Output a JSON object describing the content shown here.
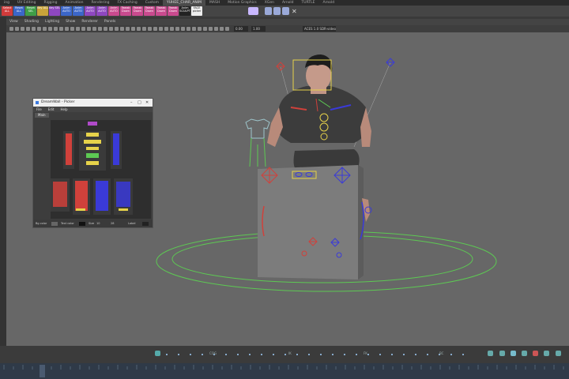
{
  "shelf_tabs": [
    "ing",
    "UV Editing",
    "Rigging",
    "Animation",
    "Rendering",
    "FX Caching",
    "Custom",
    "YUHEE_CHAR_ANIM",
    "MASH",
    "Motion Graphics",
    "XGen",
    "Arnold",
    "TURTLE",
    "Arnold"
  ],
  "active_shelf_tab_index": 7,
  "shelf_buttons": [
    {
      "label": "Select ALL",
      "color": "#d23b3b"
    },
    {
      "label": "Reset ALL",
      "color": "#3b66c9"
    },
    {
      "label": "Reset SEL",
      "color": "#3f9e47"
    },
    {
      "label": "Key ALL",
      "color": "#c9a33a"
    },
    {
      "label": "Key SEL",
      "color": "#8e47c0"
    },
    {
      "label": "Anim AUTO",
      "color": "#3b66c9"
    },
    {
      "label": "Anim AUTO",
      "color": "#3b66c9"
    },
    {
      "label": "Anim AUTO",
      "color": "#8e47c0"
    },
    {
      "label": "Anim AUTO",
      "color": "#8e47c0"
    },
    {
      "label": "Anim AUTO",
      "color": "#c94a8e"
    },
    {
      "label": "Tweak Down",
      "color": "#c94a8e"
    },
    {
      "label": "Tweak Down",
      "color": "#c94a8e"
    },
    {
      "label": "Tweak Down",
      "color": "#c94a8e"
    },
    {
      "label": "Tweak Down",
      "color": "#c94a8e"
    },
    {
      "label": "Tweak Down",
      "color": "#c94a8e"
    },
    {
      "label": "Anim SCULPT",
      "color": "#222"
    },
    {
      "label": "FACE picker",
      "color": "#eee"
    }
  ],
  "viewport_menu": [
    "View",
    "Shading",
    "Lighting",
    "Show",
    "Renderer",
    "Panels"
  ],
  "viewport_fields": {
    "exposure": "0.00",
    "gamma": "1.00",
    "color_space": "ACES 1.0 SDR-video (sRGB)"
  },
  "picker": {
    "title": "DreamWall - Picker",
    "menu": [
      "File",
      "Edit",
      "Help"
    ],
    "tab": "Main",
    "footer": {
      "bg_color_label": "Bg color",
      "text_color_label": "Text color",
      "size_label": "Size",
      "size_value": "10",
      "width_value": "28",
      "label_label": "Label"
    }
  },
  "timeline": {
    "markers": [
      "COG",
      "IK",
      "FK",
      "BC"
    ]
  },
  "colors": {
    "viewport": "#676767",
    "control_red": "#d0413b",
    "control_blue": "#3a3ad8",
    "ground_circle": "#5dc953",
    "ik_yellow": "#e6d24a",
    "picker_bg": "#2e2e2e"
  }
}
